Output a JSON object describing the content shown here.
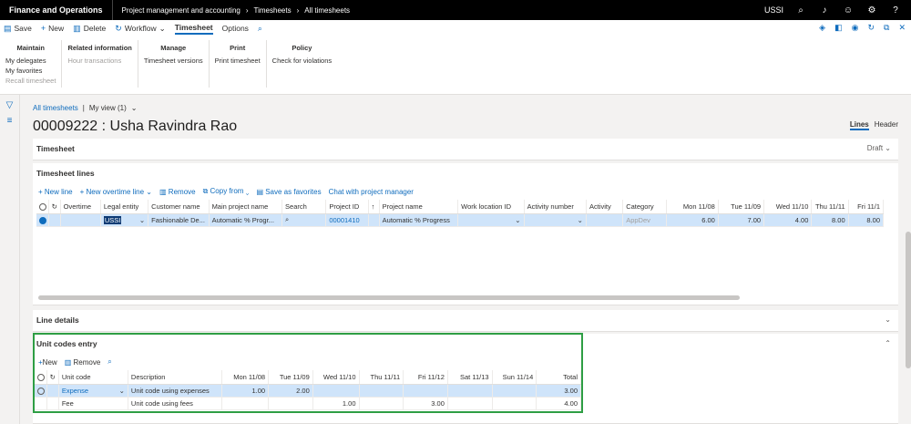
{
  "topbar": {
    "app_name": "Finance and Operations",
    "crumbs": [
      "Project management and accounting",
      "Timesheets",
      "All timesheets"
    ],
    "company": "USSI"
  },
  "actionbar": {
    "save": "Save",
    "new": "New",
    "delete": "Delete",
    "workflow": "Workflow",
    "tab_timesheet": "Timesheet",
    "tab_options": "Options"
  },
  "ribbon": {
    "maintain": {
      "title": "Maintain",
      "items": [
        "My delegates",
        "My favorites",
        "Recall timesheet"
      ]
    },
    "related": {
      "title": "Related information",
      "items": [
        "Hour transactions"
      ]
    },
    "manage": {
      "title": "Manage",
      "items": [
        "Timesheet versions"
      ]
    },
    "print": {
      "title": "Print",
      "items": [
        "Print timesheet"
      ]
    },
    "policy": {
      "title": "Policy",
      "items": [
        "Check for violations"
      ]
    }
  },
  "page": {
    "crumb_link": "All timesheets",
    "crumb_sep": "|",
    "view": "My view (1)",
    "title": "00009222 : Usha Ravindra Rao",
    "tab_lines": "Lines",
    "tab_header": "Header"
  },
  "timesheet_tab": {
    "title": "Timesheet",
    "status": "Draft"
  },
  "lines": {
    "title": "Timesheet lines",
    "toolbar": [
      "New line",
      "New overtime line",
      "Remove",
      "Copy from",
      "Save as favorites",
      "Chat with project manager"
    ],
    "columns": [
      "Overtime",
      "Legal entity",
      "Customer name",
      "Main project name",
      "Search",
      "Project ID",
      "",
      "Project name",
      "Work location ID",
      "Activity number",
      "Activity",
      "Category",
      "Mon 11/08",
      "Tue 11/09",
      "Wed 11/10",
      "Thu 11/11",
      "Fri 11/1"
    ],
    "row": {
      "legal_entity": "USSI",
      "customer": "Fashionable De...",
      "main_project": "Automatic % Progr...",
      "project_id": "00001410",
      "project_name": "Automatic % Progress",
      "category": "AppDev",
      "mon": "6.00",
      "tue": "7.00",
      "wed": "4.00",
      "thu": "8.00",
      "fri": "8.00"
    }
  },
  "line_details": {
    "title": "Line details"
  },
  "unit_codes": {
    "title": "Unit codes entry",
    "toolbar": [
      "New",
      "Remove"
    ],
    "columns": [
      "Unit code",
      "Description",
      "Mon 11/08",
      "Tue 11/09",
      "Wed 11/10",
      "Thu 11/11",
      "Fri 11/12",
      "Sat 11/13",
      "Sun 11/14",
      "Total"
    ],
    "rows": [
      {
        "code": "Expense",
        "desc": "Unit code using expenses",
        "mon": "1.00",
        "tue": "2.00",
        "wed": "",
        "thu": "",
        "fri": "",
        "sat": "",
        "sun": "",
        "total": "3.00"
      },
      {
        "code": "Fee",
        "desc": "Unit code using fees",
        "mon": "",
        "tue": "",
        "wed": "1.00",
        "thu": "",
        "fri": "3.00",
        "sat": "",
        "sun": "",
        "total": "4.00"
      }
    ]
  },
  "colors": {
    "accent": "#0f6cbd",
    "highlight_box": "#2e9e44",
    "selected_row": "#cfe4fa"
  }
}
